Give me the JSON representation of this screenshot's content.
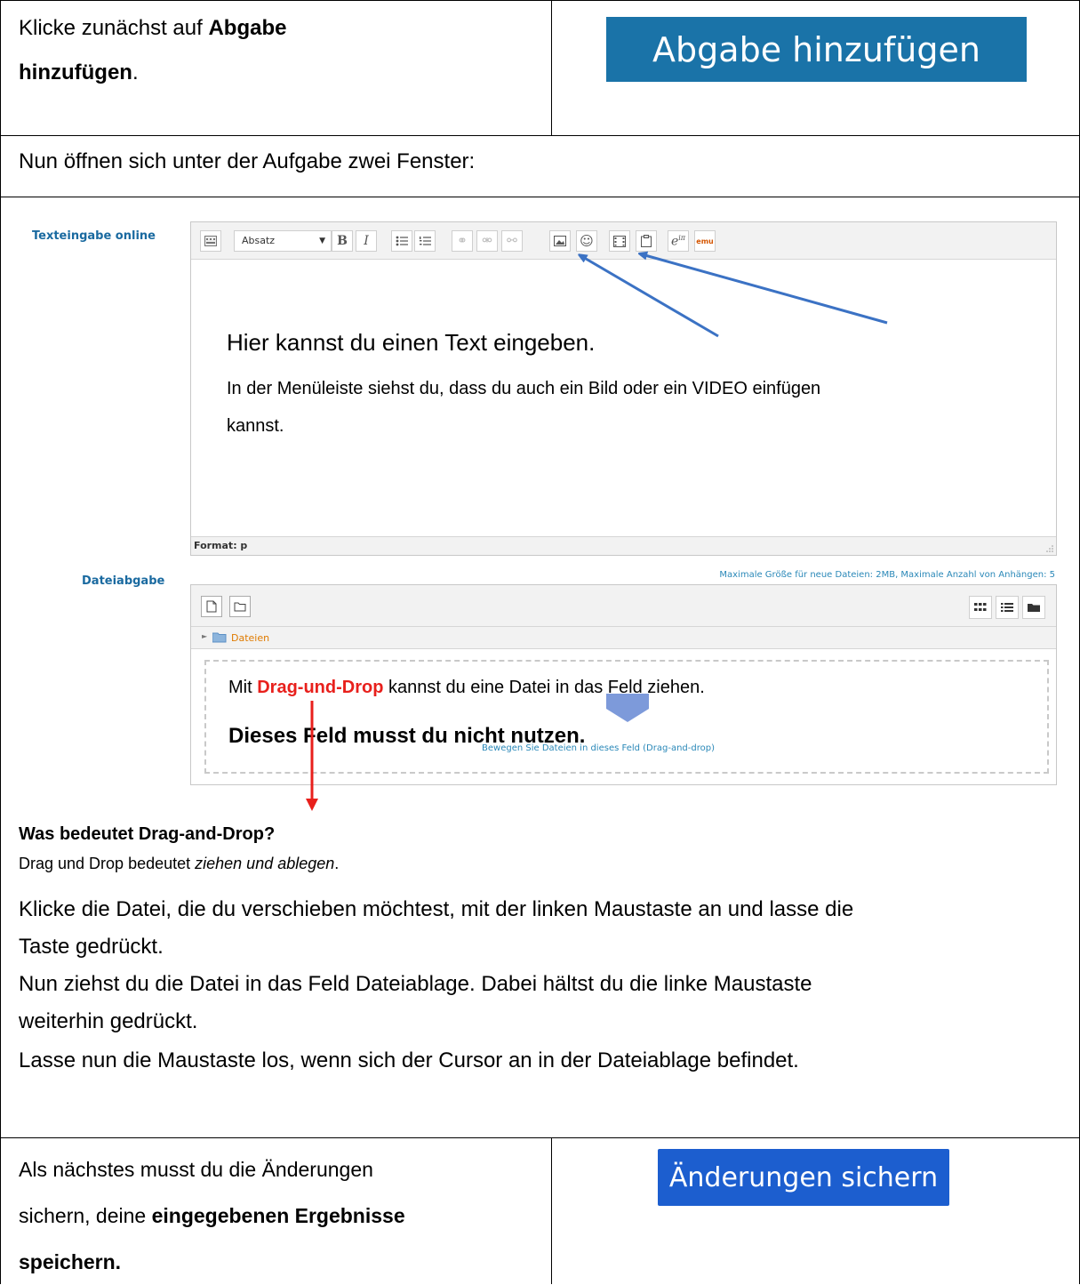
{
  "row1": {
    "instruction_prefix": "Klicke zunächst auf ",
    "instruction_bold_1": "Abgabe",
    "instruction_bold_2": "hinzufügen",
    "instruction_suffix": ".",
    "button_label": "Abgabe hinzufügen"
  },
  "row2": {
    "intro": "Nun öffnen sich unter der Aufgabe zwei Fenster:"
  },
  "editor": {
    "field_label": "Texteingabe online",
    "format_select": "Absatz",
    "status": "Format: p",
    "title": "Hier kannst du einen Text eingeben.",
    "line1": "In der Menüleiste siehst du, dass du auch ein Bild oder ein VIDEO einfügen",
    "line2": "kannst."
  },
  "files": {
    "field_label": "Dateiabgabe",
    "limits": "Maximale Größe für neue Dateien: 2MB, Maximale Anzahl von Anhängen: 5",
    "folder": "Dateien",
    "dz_prefix": "Mit ",
    "dz_red": "Drag-und-Drop",
    "dz_suffix": " kannst du eine Datei in das Feld ziehen.",
    "dz_bold": "Dieses Feld musst du nicht nutzen.",
    "dz_hint": "Bewegen Sie Dateien in dieses Feld (Drag-and-drop)"
  },
  "explain": {
    "heading": "Was bedeutet Drag-and-Drop?",
    "def_prefix": "Drag und Drop bedeutet ",
    "def_italic": "ziehen und ablegen",
    "def_suffix": ".",
    "p1a": "Klicke die Datei, die du verschieben möchtest, mit der linken Maustaste an und lasse die",
    "p1b": "Taste gedrückt.",
    "p2a": "Nun ziehst du die Datei in das Feld Dateiablage. Dabei hältst du die linke Maustaste",
    "p2b": "weiterhin gedrückt.",
    "p3": "Lasse nun die Maustaste los, wenn sich der Cursor an in der Dateiablage befindet."
  },
  "row_last": {
    "line1": "Als nächstes musst du die Änderungen",
    "line2_prefix": "sichern, deine ",
    "line2_bold": "eingegebenen Ergebnisse",
    "line3_bold": "speichern.",
    "button_label": "Änderungen sichern"
  },
  "colors": {
    "add_button": "#1a73a8",
    "save_button": "#1c5ecf",
    "arrow_blue": "#3b72c4",
    "arrow_red": "#e8201c"
  }
}
